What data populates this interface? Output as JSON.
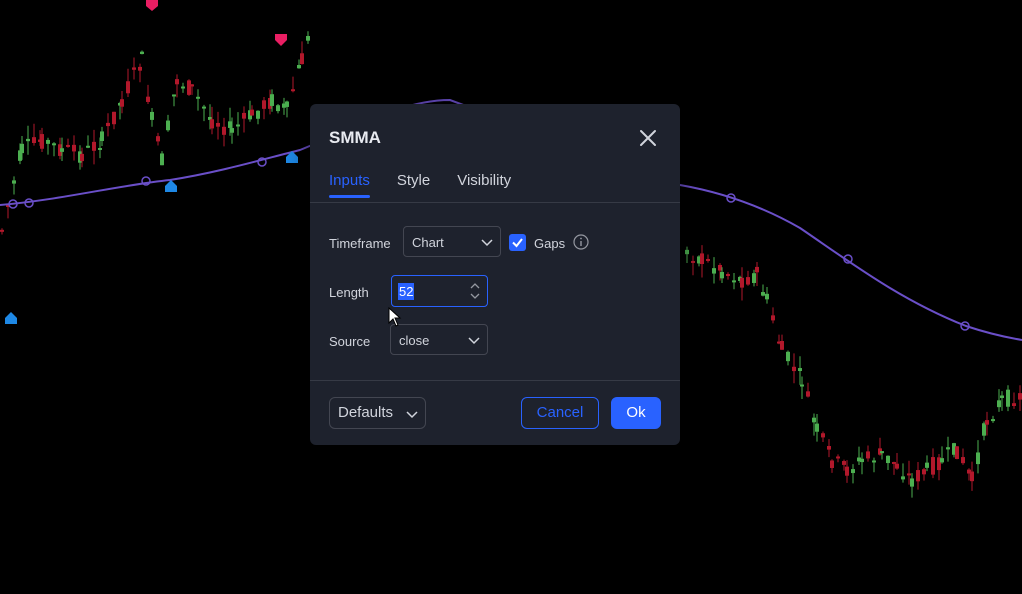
{
  "dialog": {
    "title": "SMMA",
    "tabs": [
      {
        "label": "Inputs",
        "active": true
      },
      {
        "label": "Style",
        "active": false
      },
      {
        "label": "Visibility",
        "active": false
      }
    ],
    "timeframe": {
      "label": "Timeframe",
      "value": "Chart"
    },
    "gaps": {
      "label": "Gaps",
      "checked": true
    },
    "length": {
      "label": "Length",
      "value": "52"
    },
    "source": {
      "label": "Source",
      "value": "close"
    },
    "buttons": {
      "defaults": "Defaults",
      "cancel": "Cancel",
      "ok": "Ok"
    }
  },
  "colors": {
    "accent": "#2962ff",
    "dialog_bg": "#1e222d",
    "candle_up": "#4caf50",
    "candle_down": "#b2182b",
    "smma_line": "#6a4fc8"
  },
  "icons": {
    "close": "close-icon",
    "info": "info-icon",
    "chevron": "chevron-down-icon",
    "check": "check-icon"
  }
}
